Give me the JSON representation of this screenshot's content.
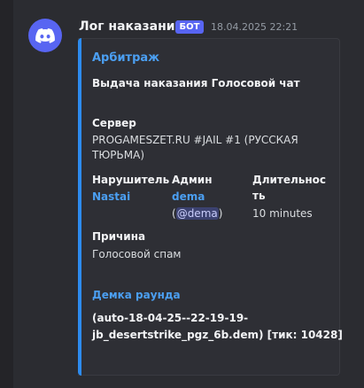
{
  "message": {
    "author": "Лог наказаний",
    "badge": "БОТ",
    "timestamp": "18.04.2025 22:21"
  },
  "embed": {
    "accent_color": "#2d8cf0",
    "title": "Арбитраж",
    "description": "Выдача наказания Голосовой чат",
    "server": {
      "label": "Сервер",
      "line1": "PROGAMESZET.RU #JAIL #1 (РУССКАЯ",
      "line2": "ТЮРЬМА)"
    },
    "offender": {
      "label": "Нарушитель",
      "value": "Nastai"
    },
    "admin": {
      "label": "Админ",
      "value": "dema",
      "paren_open": "(",
      "mention": "@dema",
      "paren_close": ")"
    },
    "duration": {
      "label_line1": "Длительнос",
      "label_line2": "ть",
      "value": "10 minutes"
    },
    "reason": {
      "label": "Причина",
      "value": "Голосовой спам"
    },
    "demo": {
      "label": "Демка раунда",
      "line1": "(auto-18-04-25--22-19-19-",
      "line2": "jb_desertstrike_pgz_6b.dem) [тик: 10428]"
    }
  },
  "icons": {
    "avatar": "discord-logo-icon"
  },
  "colors": {
    "brand": "#5865f2",
    "link": "#4b9ff2"
  }
}
